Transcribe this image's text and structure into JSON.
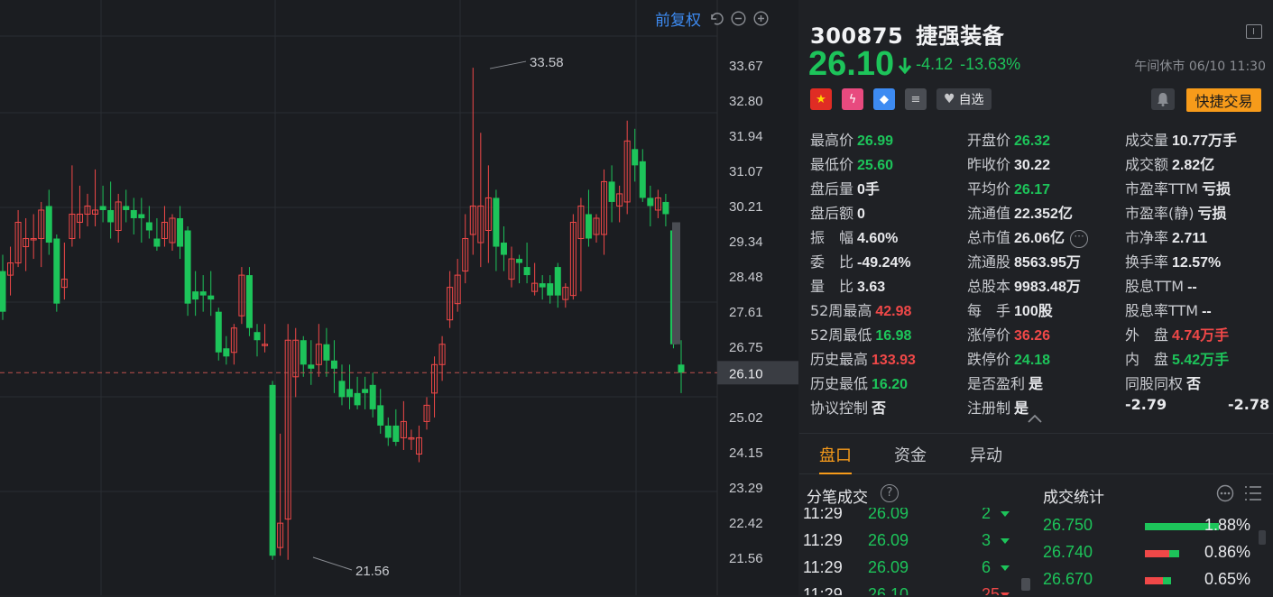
{
  "toolbar": {
    "adjust_label": "前复权"
  },
  "chart_data": {
    "type": "candlestick",
    "y_ticks": [
      "33.67",
      "32.80",
      "31.94",
      "31.07",
      "30.21",
      "29.34",
      "28.48",
      "27.61",
      "26.75",
      "26.10",
      "25.02",
      "24.15",
      "23.29",
      "22.42",
      "21.56"
    ],
    "ylim": [
      21.56,
      33.67
    ],
    "current_price_label": "26.10",
    "annotations": [
      {
        "label": "33.58",
        "value": 33.58
      },
      {
        "label": "21.56",
        "value": 21.56
      }
    ],
    "candles": [
      {
        "o": 28.6,
        "c": 27.6,
        "h": 29.0,
        "l": 27.4
      },
      {
        "o": 28.5,
        "c": 28.8,
        "h": 29.2,
        "l": 28.0
      },
      {
        "o": 28.8,
        "c": 29.8,
        "h": 30.1,
        "l": 28.7
      },
      {
        "o": 29.2,
        "c": 29.4,
        "h": 29.9,
        "l": 28.6
      },
      {
        "o": 29.4,
        "c": 29.4,
        "h": 30.0,
        "l": 28.9
      },
      {
        "o": 29.4,
        "c": 30.1,
        "h": 30.3,
        "l": 28.7
      },
      {
        "o": 30.2,
        "c": 29.3,
        "h": 30.6,
        "l": 29.0
      },
      {
        "o": 29.4,
        "c": 27.8,
        "h": 29.5,
        "l": 27.6
      },
      {
        "o": 28.2,
        "c": 28.4,
        "h": 29.3,
        "l": 27.9
      },
      {
        "o": 29.4,
        "c": 30.0,
        "h": 31.2,
        "l": 29.2
      },
      {
        "o": 29.8,
        "c": 30.0,
        "h": 30.7,
        "l": 29.4
      },
      {
        "o": 30.0,
        "c": 30.2,
        "h": 30.5,
        "l": 29.7
      },
      {
        "o": 30.0,
        "c": 30.1,
        "h": 31.1,
        "l": 29.7
      },
      {
        "o": 30.2,
        "c": 30.1,
        "h": 30.7,
        "l": 29.8
      },
      {
        "o": 30.1,
        "c": 29.8,
        "h": 30.8,
        "l": 29.4
      },
      {
        "o": 29.6,
        "c": 30.3,
        "h": 30.5,
        "l": 29.3
      },
      {
        "o": 30.2,
        "c": 30.1,
        "h": 30.6,
        "l": 29.8
      },
      {
        "o": 30.1,
        "c": 29.9,
        "h": 30.4,
        "l": 29.5
      },
      {
        "o": 30.0,
        "c": 29.9,
        "h": 30.4,
        "l": 29.3
      },
      {
        "o": 29.8,
        "c": 29.6,
        "h": 30.2,
        "l": 29.4
      },
      {
        "o": 29.4,
        "c": 29.2,
        "h": 29.9,
        "l": 29.1
      },
      {
        "o": 29.4,
        "c": 29.8,
        "h": 30.2,
        "l": 29.2
      },
      {
        "o": 29.3,
        "c": 29.9,
        "h": 30.0,
        "l": 29.1
      },
      {
        "o": 29.9,
        "c": 29.2,
        "h": 30.2,
        "l": 28.9
      },
      {
        "o": 29.6,
        "c": 27.8,
        "h": 29.7,
        "l": 27.5
      },
      {
        "o": 28.1,
        "c": 27.9,
        "h": 28.6,
        "l": 27.5
      },
      {
        "o": 28.1,
        "c": 28.0,
        "h": 28.5,
        "l": 27.6
      },
      {
        "o": 28.0,
        "c": 27.9,
        "h": 28.6,
        "l": 27.5
      },
      {
        "o": 27.6,
        "c": 26.6,
        "h": 27.7,
        "l": 26.4
      },
      {
        "o": 26.7,
        "c": 26.5,
        "h": 27.0,
        "l": 26.3
      },
      {
        "o": 26.6,
        "c": 27.2,
        "h": 27.3,
        "l": 26.3
      },
      {
        "o": 27.5,
        "c": 28.5,
        "h": 28.7,
        "l": 27.3
      },
      {
        "o": 28.5,
        "c": 27.2,
        "h": 28.7,
        "l": 27.0
      },
      {
        "o": 27.1,
        "c": 26.9,
        "h": 27.3,
        "l": 26.5
      },
      {
        "o": 26.8,
        "c": 26.8,
        "h": 27.3,
        "l": 26.6
      },
      {
        "o": 25.8,
        "c": 21.6,
        "h": 25.9,
        "l": 21.5
      },
      {
        "o": 21.8,
        "c": 22.4,
        "h": 24.6,
        "l": 21.6
      },
      {
        "o": 22.5,
        "c": 26.9,
        "h": 27.3,
        "l": 21.5
      },
      {
        "o": 26.0,
        "c": 26.9,
        "h": 27.2,
        "l": 25.5
      },
      {
        "o": 26.9,
        "c": 26.3,
        "h": 27.0,
        "l": 26.0
      },
      {
        "o": 26.3,
        "c": 26.2,
        "h": 26.9,
        "l": 25.8
      },
      {
        "o": 26.3,
        "c": 26.8,
        "h": 27.3,
        "l": 26.0
      },
      {
        "o": 26.8,
        "c": 26.4,
        "h": 27.2,
        "l": 26.0
      },
      {
        "o": 26.4,
        "c": 26.2,
        "h": 26.9,
        "l": 25.6
      },
      {
        "o": 25.9,
        "c": 25.5,
        "h": 26.3,
        "l": 25.3
      },
      {
        "o": 25.7,
        "c": 25.5,
        "h": 26.3,
        "l": 25.2
      },
      {
        "o": 25.6,
        "c": 25.3,
        "h": 26.0,
        "l": 25.2
      },
      {
        "o": 25.7,
        "c": 25.6,
        "h": 26.0,
        "l": 25.2
      },
      {
        "o": 25.8,
        "c": 25.2,
        "h": 26.1,
        "l": 25.0
      },
      {
        "o": 25.3,
        "c": 24.8,
        "h": 25.7,
        "l": 24.6
      },
      {
        "o": 24.8,
        "c": 24.5,
        "h": 25.0,
        "l": 24.3
      },
      {
        "o": 24.8,
        "c": 24.4,
        "h": 25.2,
        "l": 24.3
      },
      {
        "o": 24.5,
        "c": 24.9,
        "h": 25.4,
        "l": 24.2
      },
      {
        "o": 24.5,
        "c": 24.5,
        "h": 24.7,
        "l": 24.2
      },
      {
        "o": 24.1,
        "c": 24.5,
        "h": 24.8,
        "l": 23.9
      },
      {
        "o": 24.9,
        "c": 25.3,
        "h": 25.5,
        "l": 24.7
      },
      {
        "o": 25.6,
        "c": 26.3,
        "h": 26.5,
        "l": 25.0
      },
      {
        "o": 26.3,
        "c": 26.8,
        "h": 27.0,
        "l": 25.9
      },
      {
        "o": 27.4,
        "c": 28.2,
        "h": 28.6,
        "l": 27.2
      },
      {
        "o": 27.8,
        "c": 28.5,
        "h": 28.9,
        "l": 27.6
      },
      {
        "o": 28.6,
        "c": 29.4,
        "h": 30.0,
        "l": 28.3
      },
      {
        "o": 29.5,
        "c": 30.2,
        "h": 33.6,
        "l": 29.0
      },
      {
        "o": 29.3,
        "c": 30.2,
        "h": 32.0,
        "l": 28.7
      },
      {
        "o": 29.6,
        "c": 30.4,
        "h": 31.2,
        "l": 28.8
      },
      {
        "o": 30.4,
        "c": 29.2,
        "h": 30.6,
        "l": 28.6
      },
      {
        "o": 29.3,
        "c": 29.0,
        "h": 29.7,
        "l": 28.6
      },
      {
        "o": 28.4,
        "c": 28.9,
        "h": 29.2,
        "l": 28.2
      },
      {
        "o": 28.9,
        "c": 28.8,
        "h": 29.0,
        "l": 28.3
      },
      {
        "o": 28.7,
        "c": 28.5,
        "h": 29.3,
        "l": 28.3
      },
      {
        "o": 28.1,
        "c": 28.3,
        "h": 28.8,
        "l": 28.0
      },
      {
        "o": 28.3,
        "c": 28.2,
        "h": 28.5,
        "l": 27.9
      },
      {
        "o": 28.3,
        "c": 28.0,
        "h": 28.5,
        "l": 27.8
      },
      {
        "o": 28.7,
        "c": 28.0,
        "h": 28.8,
        "l": 27.7
      },
      {
        "o": 27.9,
        "c": 28.2,
        "h": 28.3,
        "l": 27.7
      },
      {
        "o": 28.0,
        "c": 29.8,
        "h": 30.0,
        "l": 27.9
      },
      {
        "o": 29.4,
        "c": 30.2,
        "h": 30.4,
        "l": 28.1
      },
      {
        "o": 30.0,
        "c": 29.4,
        "h": 30.6,
        "l": 29.2
      },
      {
        "o": 29.5,
        "c": 29.9,
        "h": 30.0,
        "l": 29.3
      },
      {
        "o": 29.5,
        "c": 30.8,
        "h": 31.1,
        "l": 29.0
      },
      {
        "o": 30.8,
        "c": 30.3,
        "h": 31.2,
        "l": 29.8
      },
      {
        "o": 30.2,
        "c": 30.5,
        "h": 30.7,
        "l": 29.8
      },
      {
        "o": 30.3,
        "c": 31.8,
        "h": 32.3,
        "l": 30.0
      },
      {
        "o": 31.6,
        "c": 31.2,
        "h": 32.1,
        "l": 30.8
      },
      {
        "o": 31.3,
        "c": 30.4,
        "h": 31.6,
        "l": 30.3
      },
      {
        "o": 30.4,
        "c": 30.2,
        "h": 30.7,
        "l": 29.7
      },
      {
        "o": 30.1,
        "c": 30.4,
        "h": 30.6,
        "l": 29.9
      },
      {
        "o": 30.3,
        "c": 30.0,
        "h": 30.5,
        "l": 29.7
      },
      {
        "o": 29.6,
        "c": 26.8,
        "h": 29.7,
        "l": 26.7
      },
      {
        "o": 26.3,
        "c": 26.1,
        "h": 26.9,
        "l": 25.6
      }
    ]
  },
  "stock": {
    "code": "300875",
    "name": "捷强装备",
    "price": "26.10",
    "change": "-4.12",
    "change_pct": "-13.63%",
    "status_time": "午间休市 06/10 11:30",
    "watch_label": "自选",
    "quick_trade_label": "快捷交易"
  },
  "stats": {
    "col1": [
      {
        "label": "最高价",
        "value": "26.99"
      },
      {
        "label": "最低价",
        "value": "25.60"
      },
      {
        "label": "盘后量",
        "value": "0手"
      },
      {
        "label": "盘后额",
        "value": "0"
      },
      {
        "label": "振　幅",
        "value": "4.60%"
      },
      {
        "label": "委　比",
        "value": "-49.24%"
      },
      {
        "label": "量　比",
        "value": "3.63"
      },
      {
        "label": "52周最高",
        "value": "42.98"
      },
      {
        "label": "52周最低",
        "value": "16.98"
      },
      {
        "label": "历史最高",
        "value": "133.93"
      },
      {
        "label": "历史最低",
        "value": "16.20"
      },
      {
        "label": "协议控制",
        "value": "否"
      }
    ],
    "col2": [
      {
        "label": "开盘价",
        "value": "26.32"
      },
      {
        "label": "昨收价",
        "value": "30.22"
      },
      {
        "label": "平均价",
        "value": "26.17"
      },
      {
        "label": "流通值",
        "value": "22.352亿"
      },
      {
        "label": "总市值",
        "value": "26.06亿"
      },
      {
        "label": "流通股",
        "value": "8563.95万"
      },
      {
        "label": "总股本",
        "value": "9983.48万"
      },
      {
        "label": "每　手",
        "value": "100股"
      },
      {
        "label": "涨停价",
        "value": "36.26"
      },
      {
        "label": "跌停价",
        "value": "24.18"
      },
      {
        "label": "是否盈利",
        "value": "是"
      },
      {
        "label": "注册制",
        "value": "是"
      }
    ],
    "col3": [
      {
        "label": "成交量",
        "value": "10.77万手"
      },
      {
        "label": "成交额",
        "value": "2.82亿"
      },
      {
        "label": "市盈率TTM",
        "value": "亏损"
      },
      {
        "label": "市盈率(静)",
        "value": "亏损"
      },
      {
        "label": "市净率",
        "value": "2.711"
      },
      {
        "label": "换手率",
        "value": "12.57%"
      },
      {
        "label": "股息TTM",
        "value": "--"
      },
      {
        "label": "股息率TTM",
        "value": "--"
      },
      {
        "label": "外　盘",
        "value": "4.74万手"
      },
      {
        "label": "内　盘",
        "value": "5.42万手"
      },
      {
        "label": "同股同权",
        "value": "否"
      }
    ],
    "extra_left": "-2.79",
    "extra_right": "-2.78"
  },
  "tabs": [
    "盘口",
    "资金",
    "异动"
  ],
  "ticks_section": {
    "title": "分笔成交",
    "rows": [
      {
        "time": "11:29",
        "price": "26.09",
        "qty": "2"
      },
      {
        "time": "11:29",
        "price": "26.09",
        "qty": "3"
      },
      {
        "time": "11:29",
        "price": "26.09",
        "qty": "6"
      },
      {
        "time": "11:29",
        "price": "26.10",
        "qty": "25"
      }
    ]
  },
  "volume_section": {
    "title": "成交统计",
    "rows": [
      {
        "price": "26.750",
        "pct": "1.88%",
        "share": 1.0
      },
      {
        "price": "26.740",
        "pct": "0.86%",
        "share": 0.46
      },
      {
        "price": "26.670",
        "pct": "0.65%",
        "share": 0.35
      }
    ]
  },
  "colors": {
    "up": "#f04848",
    "down": "#1dc45a",
    "accent": "#f79b1a",
    "link": "#3d8bf2"
  }
}
